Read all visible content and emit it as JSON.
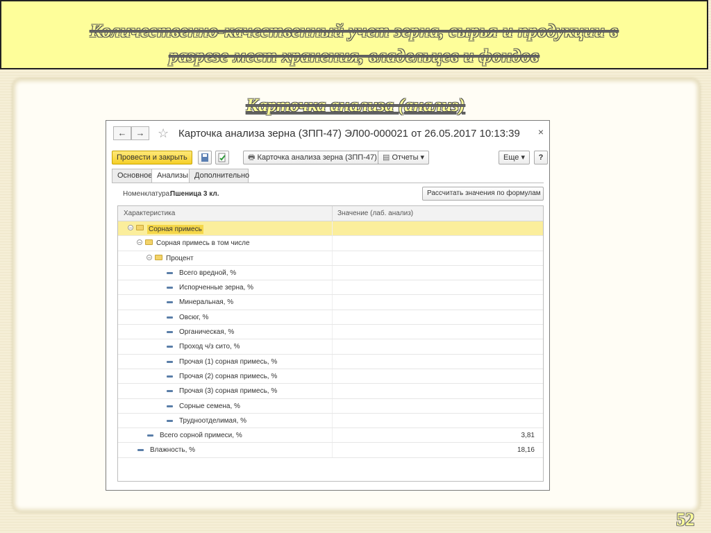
{
  "slide": {
    "title_line1": "Количественно-качественный учет зерна, сырья и продукции в",
    "title_line2": "разрезе мест хранения, владельцев и фондов",
    "subtitle": "Карточка анализа (анализ)",
    "page_number": "52"
  },
  "window": {
    "title": "Карточка анализа зерна (ЗПП-47) ЭЛ00-000021 от 26.05.2017 10:13:39",
    "back": "←",
    "forward": "→",
    "star": "☆",
    "close": "×"
  },
  "toolbar": {
    "post_close": "Провести и закрыть",
    "print_card": "Карточка анализа зерна (ЗПП-47)",
    "reports": "Отчеты",
    "more": "Еще",
    "help": "?"
  },
  "tabs": [
    "Основное",
    "Анализы",
    "Дополнительно"
  ],
  "nomenclature": {
    "label": "Номенклатура:",
    "value": "Пшеница 3 кл."
  },
  "calc_button": "Рассчитать значения по формулам",
  "table": {
    "col1": "Характеристика",
    "col2": "Значение (лаб. анализ)",
    "rows": [
      {
        "label": "Сорная примесь",
        "value": "",
        "type": "group"
      },
      {
        "label": "Сорная примесь в том числе",
        "value": "",
        "type": "group"
      },
      {
        "label": "Процент",
        "value": "",
        "type": "group"
      },
      {
        "label": "Всего вредной, %",
        "value": "",
        "type": "item"
      },
      {
        "label": "Испорченные зерна, %",
        "value": "",
        "type": "item"
      },
      {
        "label": "Минеральная, %",
        "value": "",
        "type": "item"
      },
      {
        "label": "Овсюг, %",
        "value": "",
        "type": "item"
      },
      {
        "label": "Органическая, %",
        "value": "",
        "type": "item"
      },
      {
        "label": "Проход ч/з сито, %",
        "value": "",
        "type": "item"
      },
      {
        "label": "Прочая (1) сорная примесь, %",
        "value": "",
        "type": "item"
      },
      {
        "label": "Прочая (2) сорная примесь, %",
        "value": "",
        "type": "item"
      },
      {
        "label": "Прочая (3) сорная примесь, %",
        "value": "",
        "type": "item"
      },
      {
        "label": "Сорные семена, %",
        "value": "",
        "type": "item"
      },
      {
        "label": "Трудноотделимая, %",
        "value": "",
        "type": "item"
      },
      {
        "label": "Всего сорной примеси, %",
        "value": "3,81",
        "type": "item"
      },
      {
        "label": "Влажность, %",
        "value": "18,16",
        "type": "item"
      }
    ]
  }
}
